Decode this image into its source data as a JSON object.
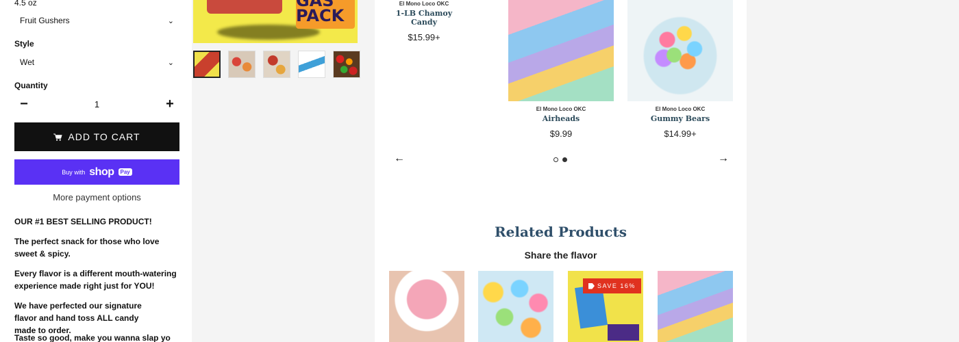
{
  "product": {
    "size_text": "4.5 oz",
    "flavor_value": "Fruit Gushers",
    "style_label": "Style",
    "style_value": "Wet",
    "quantity_label": "Quantity",
    "quantity_value": "1",
    "add_to_cart_label": "ADD TO CART",
    "buy_with_label": "Buy with",
    "shop_label": "shop",
    "pay_label": "Pay",
    "more_payment_label": "More payment options",
    "description": [
      "OUR #1 BEST SELLING PRODUCT!",
      "The perfect snack for those who love sweet & spicy.",
      "Every flavor is a different mouth-watering experience made right just for YOU!",
      "We have perfected our signature flavor and hand toss ALL candy made to order.",
      "Taste so good, make you wanna slap yo mama!"
    ]
  },
  "gallery": {
    "main_text": "GAS PACK",
    "thumb_count": 5
  },
  "carousel": {
    "items": [
      {
        "vendor": "El Mono Loco OKC",
        "name": "1-LB Chamoy Candy",
        "price": "$15.99+"
      },
      {
        "vendor": "El Mono Loco OKC",
        "name": "Airheads",
        "price": "$9.99"
      },
      {
        "vendor": "El Mono Loco OKC",
        "name": "Gummy Bears",
        "price": "$14.99+"
      }
    ]
  },
  "related": {
    "title": "Related Products",
    "subtitle": "Share the flavor",
    "save_badge": "SAVE 16%"
  },
  "colors": {
    "accent": "#5a31f4",
    "title": "#2f4f6a",
    "save": "#e0321f"
  }
}
